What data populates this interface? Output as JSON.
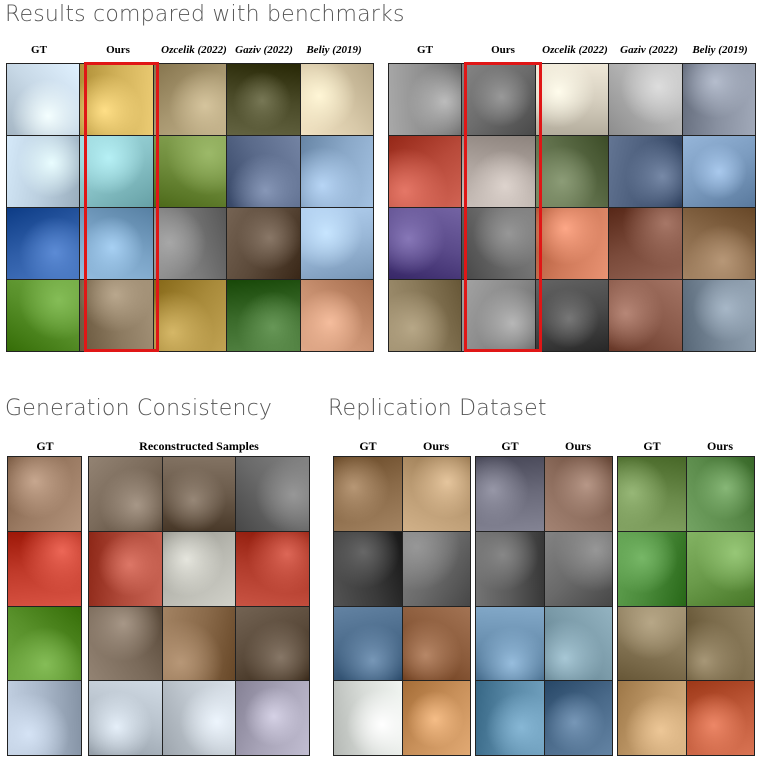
{
  "titles": {
    "benchmarks": "Results compared with benchmarks",
    "consistency": "Generation Consistency",
    "replication": "Replication Dataset"
  },
  "benchmarks": {
    "columns": [
      "GT",
      "Ours",
      "Ozcelik (2022)",
      "Gaziv (2022)",
      "Beliy (2019)"
    ],
    "left": {
      "rows": [
        [
          "#c7d8e6",
          "#d2b25a",
          "#a89770",
          "#4a4a28",
          "#d8c9a9"
        ],
        [
          "#bcd0e0",
          "#89c3c8",
          "#6f8c3c",
          "#5a6a8a",
          "#8aa8c8"
        ],
        [
          "#2f5ea8",
          "#7aa3c6",
          "#7a7a7a",
          "#5c4a3a",
          "#9ab8d8"
        ],
        [
          "#58902a",
          "#8c7a60",
          "#a88a3a",
          "#3a6a2a",
          "#c89070"
        ]
      ]
    },
    "right": {
      "rows": [
        [
          "#8f8f8f",
          "#6c6c6c",
          "#d6cfbf",
          "#b0b0b0",
          "#8890a0"
        ],
        [
          "#b84a3a",
          "#b0a6a0",
          "#5f6f4a",
          "#4a5c7a",
          "#7c9cc0"
        ],
        [
          "#5a4a8a",
          "#6a6a6a",
          "#d07a5a",
          "#7a4a3a",
          "#8a6a4a"
        ],
        [
          "#8a7a5a",
          "#8a8a8a",
          "#4a4a4a",
          "#8a5a4a",
          "#7a8a9a"
        ]
      ]
    }
  },
  "consistency": {
    "gt_label": "GT",
    "recon_label": "Reconstructed Samples",
    "rows": [
      [
        "#9a7a62",
        "#7a6a5a",
        "#6a5a4a",
        "#6a6a6a"
      ],
      [
        "#c03a2a",
        "#b04a3a",
        "#b8b8b0",
        "#b03a2a"
      ],
      [
        "#58902a",
        "#7a6a5a",
        "#8a6a4a",
        "#5a4a3a"
      ],
      [
        "#a8b6c8",
        "#b8c2cc",
        "#c0c8d0",
        "#a8a4b8"
      ]
    ]
  },
  "replication": {
    "col_labels": [
      "GT",
      "Ours"
    ],
    "groups": [
      {
        "rows": [
          [
            "#8a6a48",
            "#b89870"
          ],
          [
            "#3a3a3a",
            "#6a6a6a"
          ],
          [
            "#4a6a8a",
            "#8a5a3a"
          ],
          [
            "#d8dcd8",
            "#c8905a"
          ]
        ]
      },
      {
        "rows": [
          [
            "#6a6a7a",
            "#8a6a5a"
          ],
          [
            "#5a5a5a",
            "#6a6a6a"
          ],
          [
            "#6a90b0",
            "#7a9aa8"
          ],
          [
            "#5a8aa8",
            "#4a6a8a"
          ]
        ]
      },
      {
        "rows": [
          [
            "#6a8a4a",
            "#5a8a4a"
          ],
          [
            "#4a8a3a",
            "#6a9a4a"
          ],
          [
            "#8a7a5a",
            "#7a6a4a"
          ],
          [
            "#c09a6a",
            "#c05a3a"
          ]
        ]
      }
    ]
  }
}
